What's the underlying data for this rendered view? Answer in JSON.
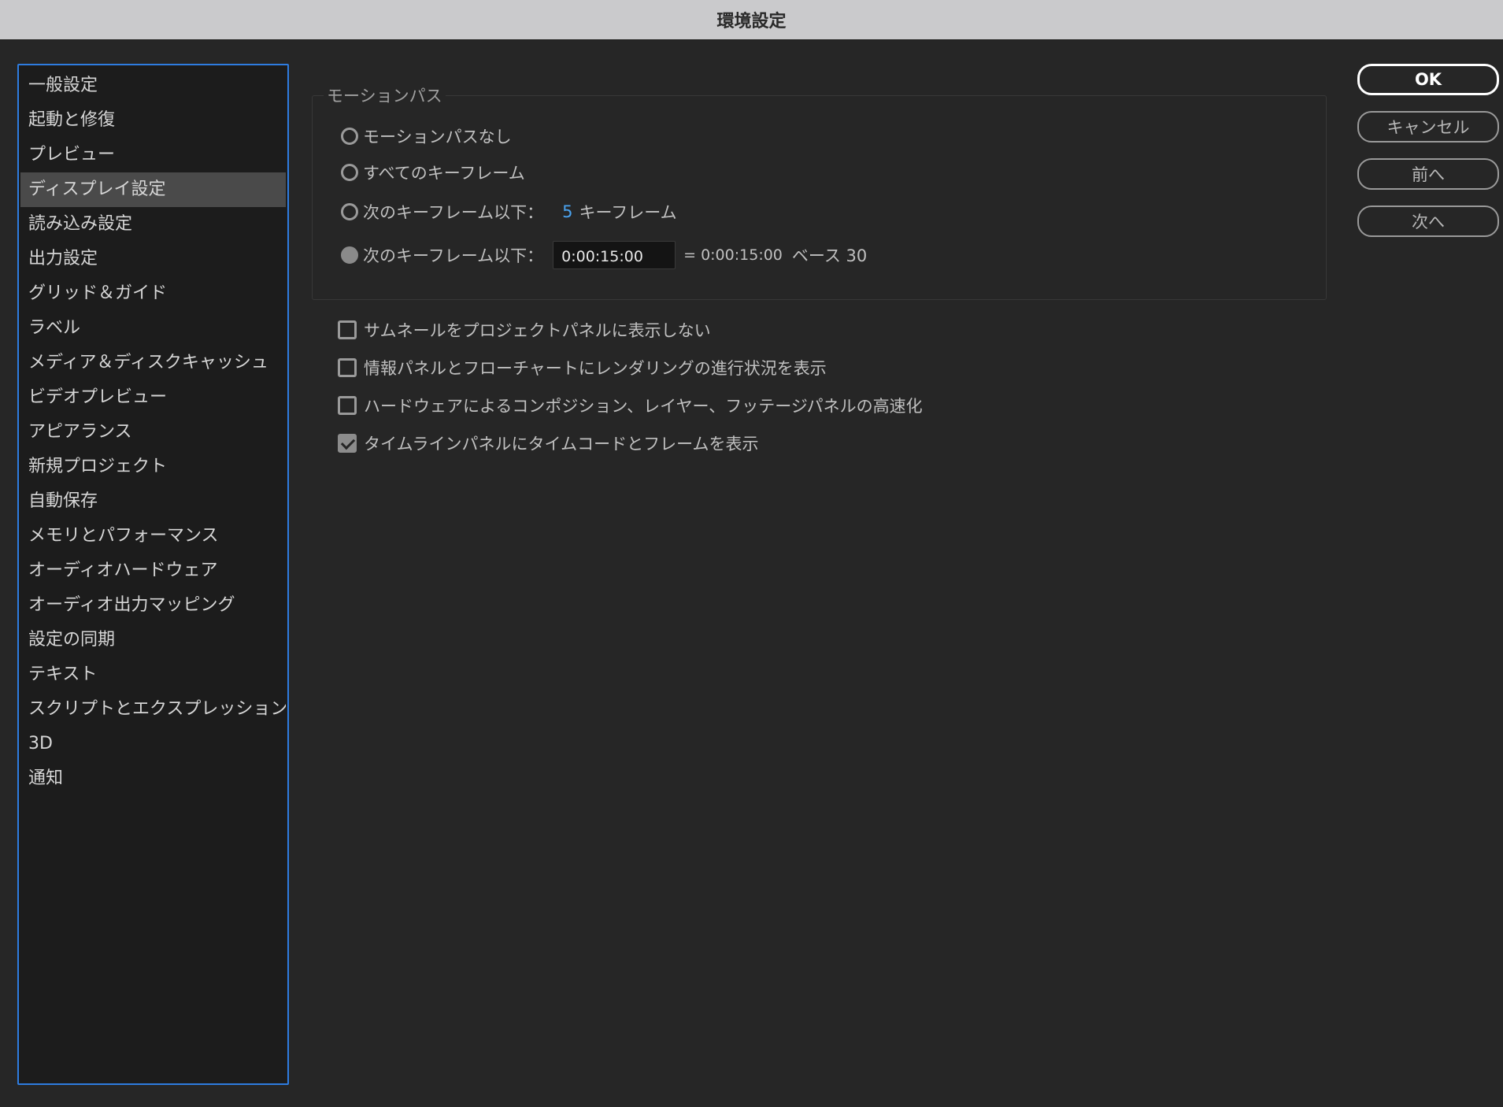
{
  "window": {
    "title": "環境設定"
  },
  "sidebar": {
    "items": [
      {
        "label": "一般設定"
      },
      {
        "label": "起動と修復"
      },
      {
        "label": "プレビュー"
      },
      {
        "label": "ディスプレイ設定",
        "selected": true
      },
      {
        "label": "読み込み設定"
      },
      {
        "label": "出力設定"
      },
      {
        "label": "グリッド＆ガイド"
      },
      {
        "label": "ラベル"
      },
      {
        "label": "メディア＆ディスクキャッシュ"
      },
      {
        "label": "ビデオプレビュー"
      },
      {
        "label": "アピアランス"
      },
      {
        "label": "新規プロジェクト"
      },
      {
        "label": "自動保存"
      },
      {
        "label": "メモリとパフォーマンス"
      },
      {
        "label": "オーディオハードウェア"
      },
      {
        "label": "オーディオ出力マッピング"
      },
      {
        "label": "設定の同期"
      },
      {
        "label": "テキスト"
      },
      {
        "label": "スクリプトとエクスプレッション"
      },
      {
        "label": "3D"
      },
      {
        "label": "通知"
      }
    ]
  },
  "motion_path": {
    "group_title": "モーションパス",
    "options": [
      {
        "label": "モーションパスなし",
        "selected": false
      },
      {
        "label": "すべてのキーフレーム",
        "selected": false
      },
      {
        "label": "次のキーフレーム以下：",
        "value": "5",
        "suffix": "キーフレーム",
        "selected": false
      },
      {
        "label": "次のキーフレーム以下：",
        "input_value": "0:00:15:00",
        "equivalent": "= 0:00:15:00",
        "base": "ベース 30",
        "selected": true
      }
    ]
  },
  "checkboxes": [
    {
      "label": "サムネールをプロジェクトパネルに表示しない",
      "checked": false
    },
    {
      "label": "情報パネルとフローチャートにレンダリングの進行状況を表示",
      "checked": false
    },
    {
      "label": "ハードウェアによるコンポジション、レイヤー、フッテージパネルの高速化",
      "checked": false
    },
    {
      "label": "タイムラインパネルにタイムコードとフレームを表示",
      "checked": true
    }
  ],
  "buttons": {
    "ok": "OK",
    "cancel": "キャンセル",
    "prev": "前へ",
    "next": "次へ"
  },
  "colors": {
    "accent_border": "#2e7ce0",
    "link_value": "#4aa3f0",
    "background": "#262626"
  }
}
